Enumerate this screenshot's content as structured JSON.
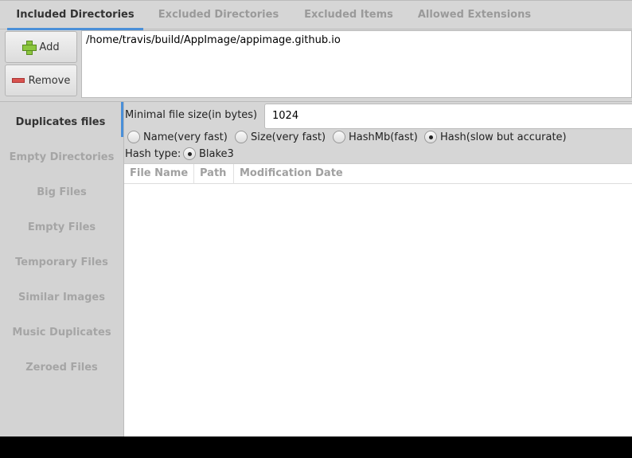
{
  "tabs": [
    "Included Directories",
    "Excluded Directories",
    "Excluded Items",
    "Allowed Extensions"
  ],
  "dirs": {
    "add_label": "Add",
    "remove_label": "Remove",
    "items": [
      "/home/travis/build/AppImage/appimage.github.io"
    ]
  },
  "sidebar": [
    "Duplicates files",
    "Empty Directories",
    "Big Files",
    "Empty Files",
    "Temporary Files",
    "Similar Images",
    "Music Duplicates",
    "Zeroed Files"
  ],
  "main": {
    "min_size_label": "Minimal file size(in bytes)",
    "min_size_value": "1024",
    "check_methods": [
      {
        "label": "Name(very fast)",
        "selected": false
      },
      {
        "label": "Size(very fast)",
        "selected": false
      },
      {
        "label": "HashMb(fast)",
        "selected": false
      },
      {
        "label": "Hash(slow but accurate)",
        "selected": true
      }
    ],
    "hash_type_label": "Hash type:",
    "hash_type": {
      "label": "Blake3",
      "selected": true
    },
    "columns": [
      "File Name",
      "Path",
      "Modification Date"
    ]
  },
  "colors": {
    "accent": "#4a8fd8"
  }
}
